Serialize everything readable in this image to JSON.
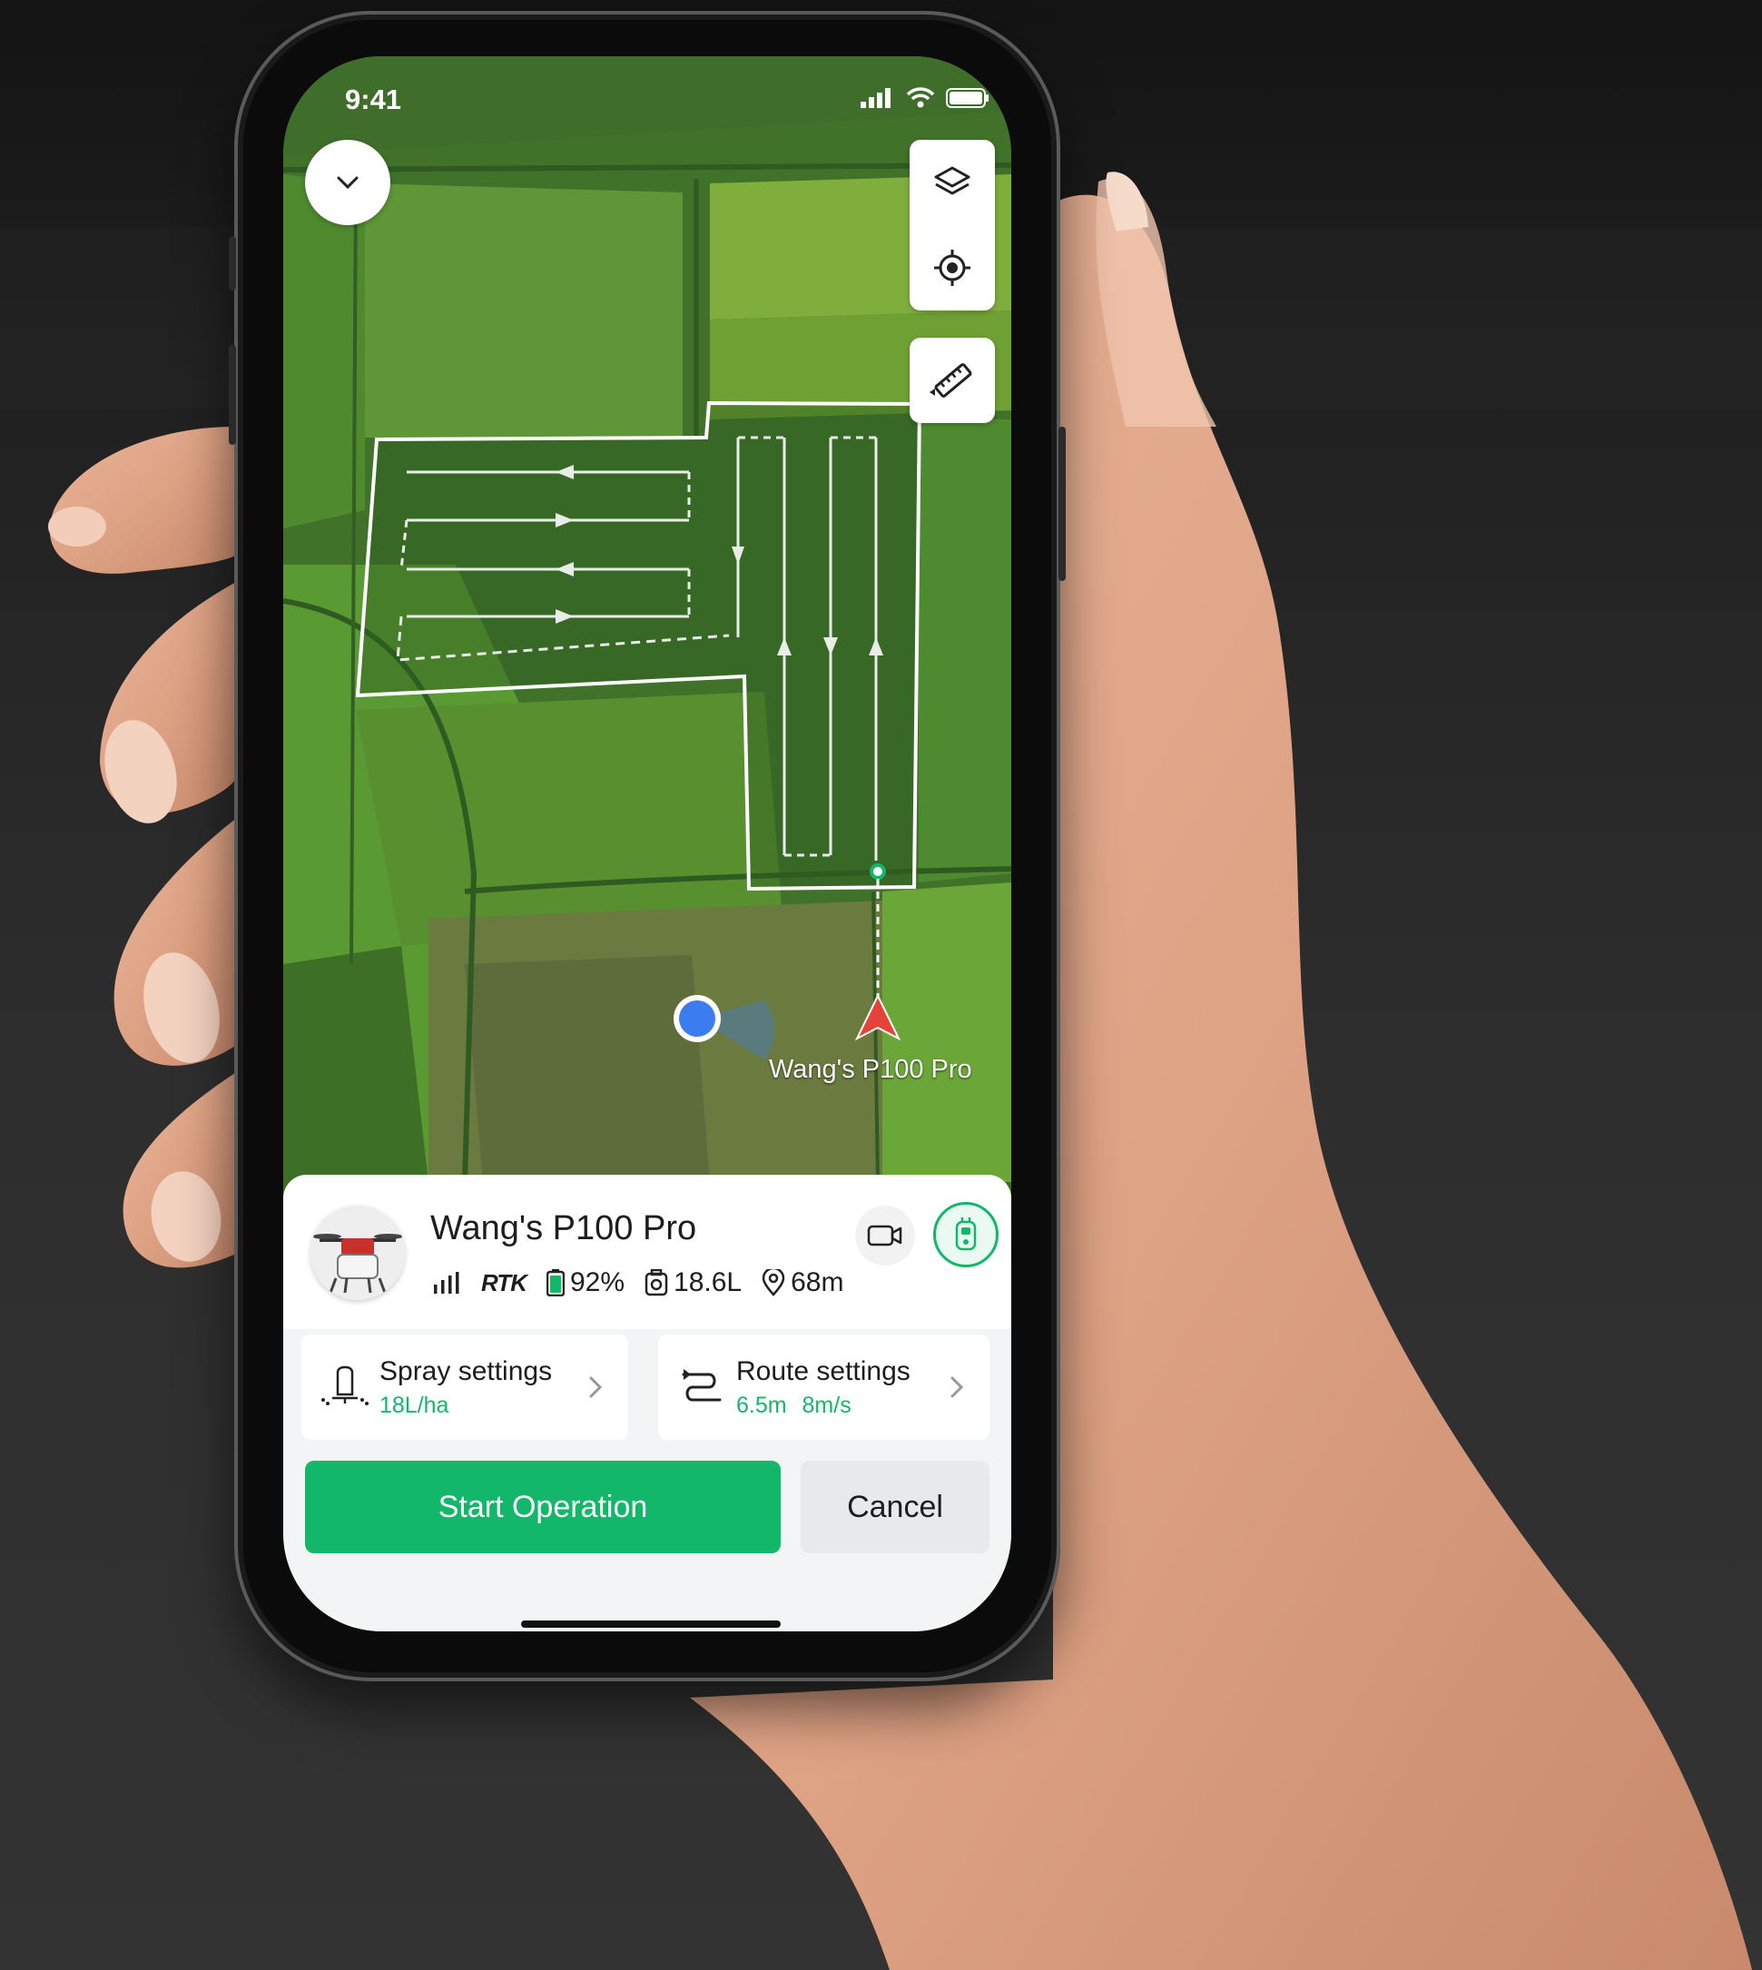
{
  "status_bar": {
    "time": "9:41"
  },
  "map": {
    "drone_label": "Wang's P100 Pro",
    "icons": [
      "chevron-down-icon",
      "layers-icon",
      "locate-icon",
      "ruler-icon"
    ]
  },
  "drone": {
    "name": "Wang's P100 Pro",
    "rtk_label": "RTK",
    "battery": "92%",
    "tank": "18.6L",
    "distance": "68m"
  },
  "spray": {
    "title": "Spray settings",
    "value": "18L/ha"
  },
  "route": {
    "title": "Route settings",
    "value": "6.5m  8m/s"
  },
  "actions": {
    "start": "Start Operation",
    "cancel": "Cancel"
  },
  "colors": {
    "accent": "#12b76a",
    "drone_marker": "#e5423a",
    "user_marker": "#3b7df0"
  }
}
